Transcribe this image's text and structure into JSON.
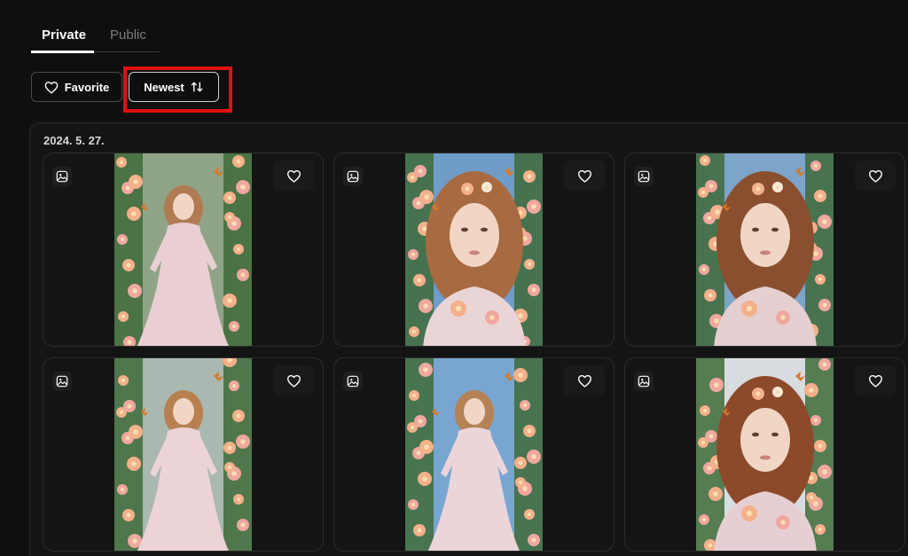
{
  "tabs": [
    {
      "label": "Private",
      "active": true
    },
    {
      "label": "Public",
      "active": false
    }
  ],
  "toolbar": {
    "favorite_label": "Favorite",
    "newest_label": "Newest"
  },
  "gallery": {
    "date": "2024. 5. 27.",
    "images": [
      {
        "scene": "woman-flowers-seated",
        "sky": "#8fa487",
        "dress": "#e9cfd2",
        "hair": "#b07a52"
      },
      {
        "scene": "woman-portrait-sky",
        "sky": "#6f9cc8",
        "dress": "#ead5d6",
        "hair": "#a86a40"
      },
      {
        "scene": "woman-portrait-roses",
        "sky": "#7da4c9",
        "dress": "#e5cfd0",
        "hair": "#8a4f2e"
      },
      {
        "scene": "woman-arch-seated",
        "sky": "#a9b8b0",
        "dress": "#ecd3d6",
        "hair": "#b88050"
      },
      {
        "scene": "woman-garden-standing",
        "sky": "#79a6d1",
        "dress": "#ecd5d9",
        "hair": "#b58255"
      },
      {
        "scene": "woman-portrait-butterflies",
        "sky": "#d6dcdf",
        "dress": "#e6cfd2",
        "hair": "#8c4a2b"
      }
    ]
  },
  "colors": {
    "background": "#0f0f0f",
    "panel": "#141414",
    "highlight": "#e01010",
    "petal_pink": "#f0a7a0",
    "petal_peach": "#f3b08a",
    "leaf": "#3f6b3a"
  }
}
